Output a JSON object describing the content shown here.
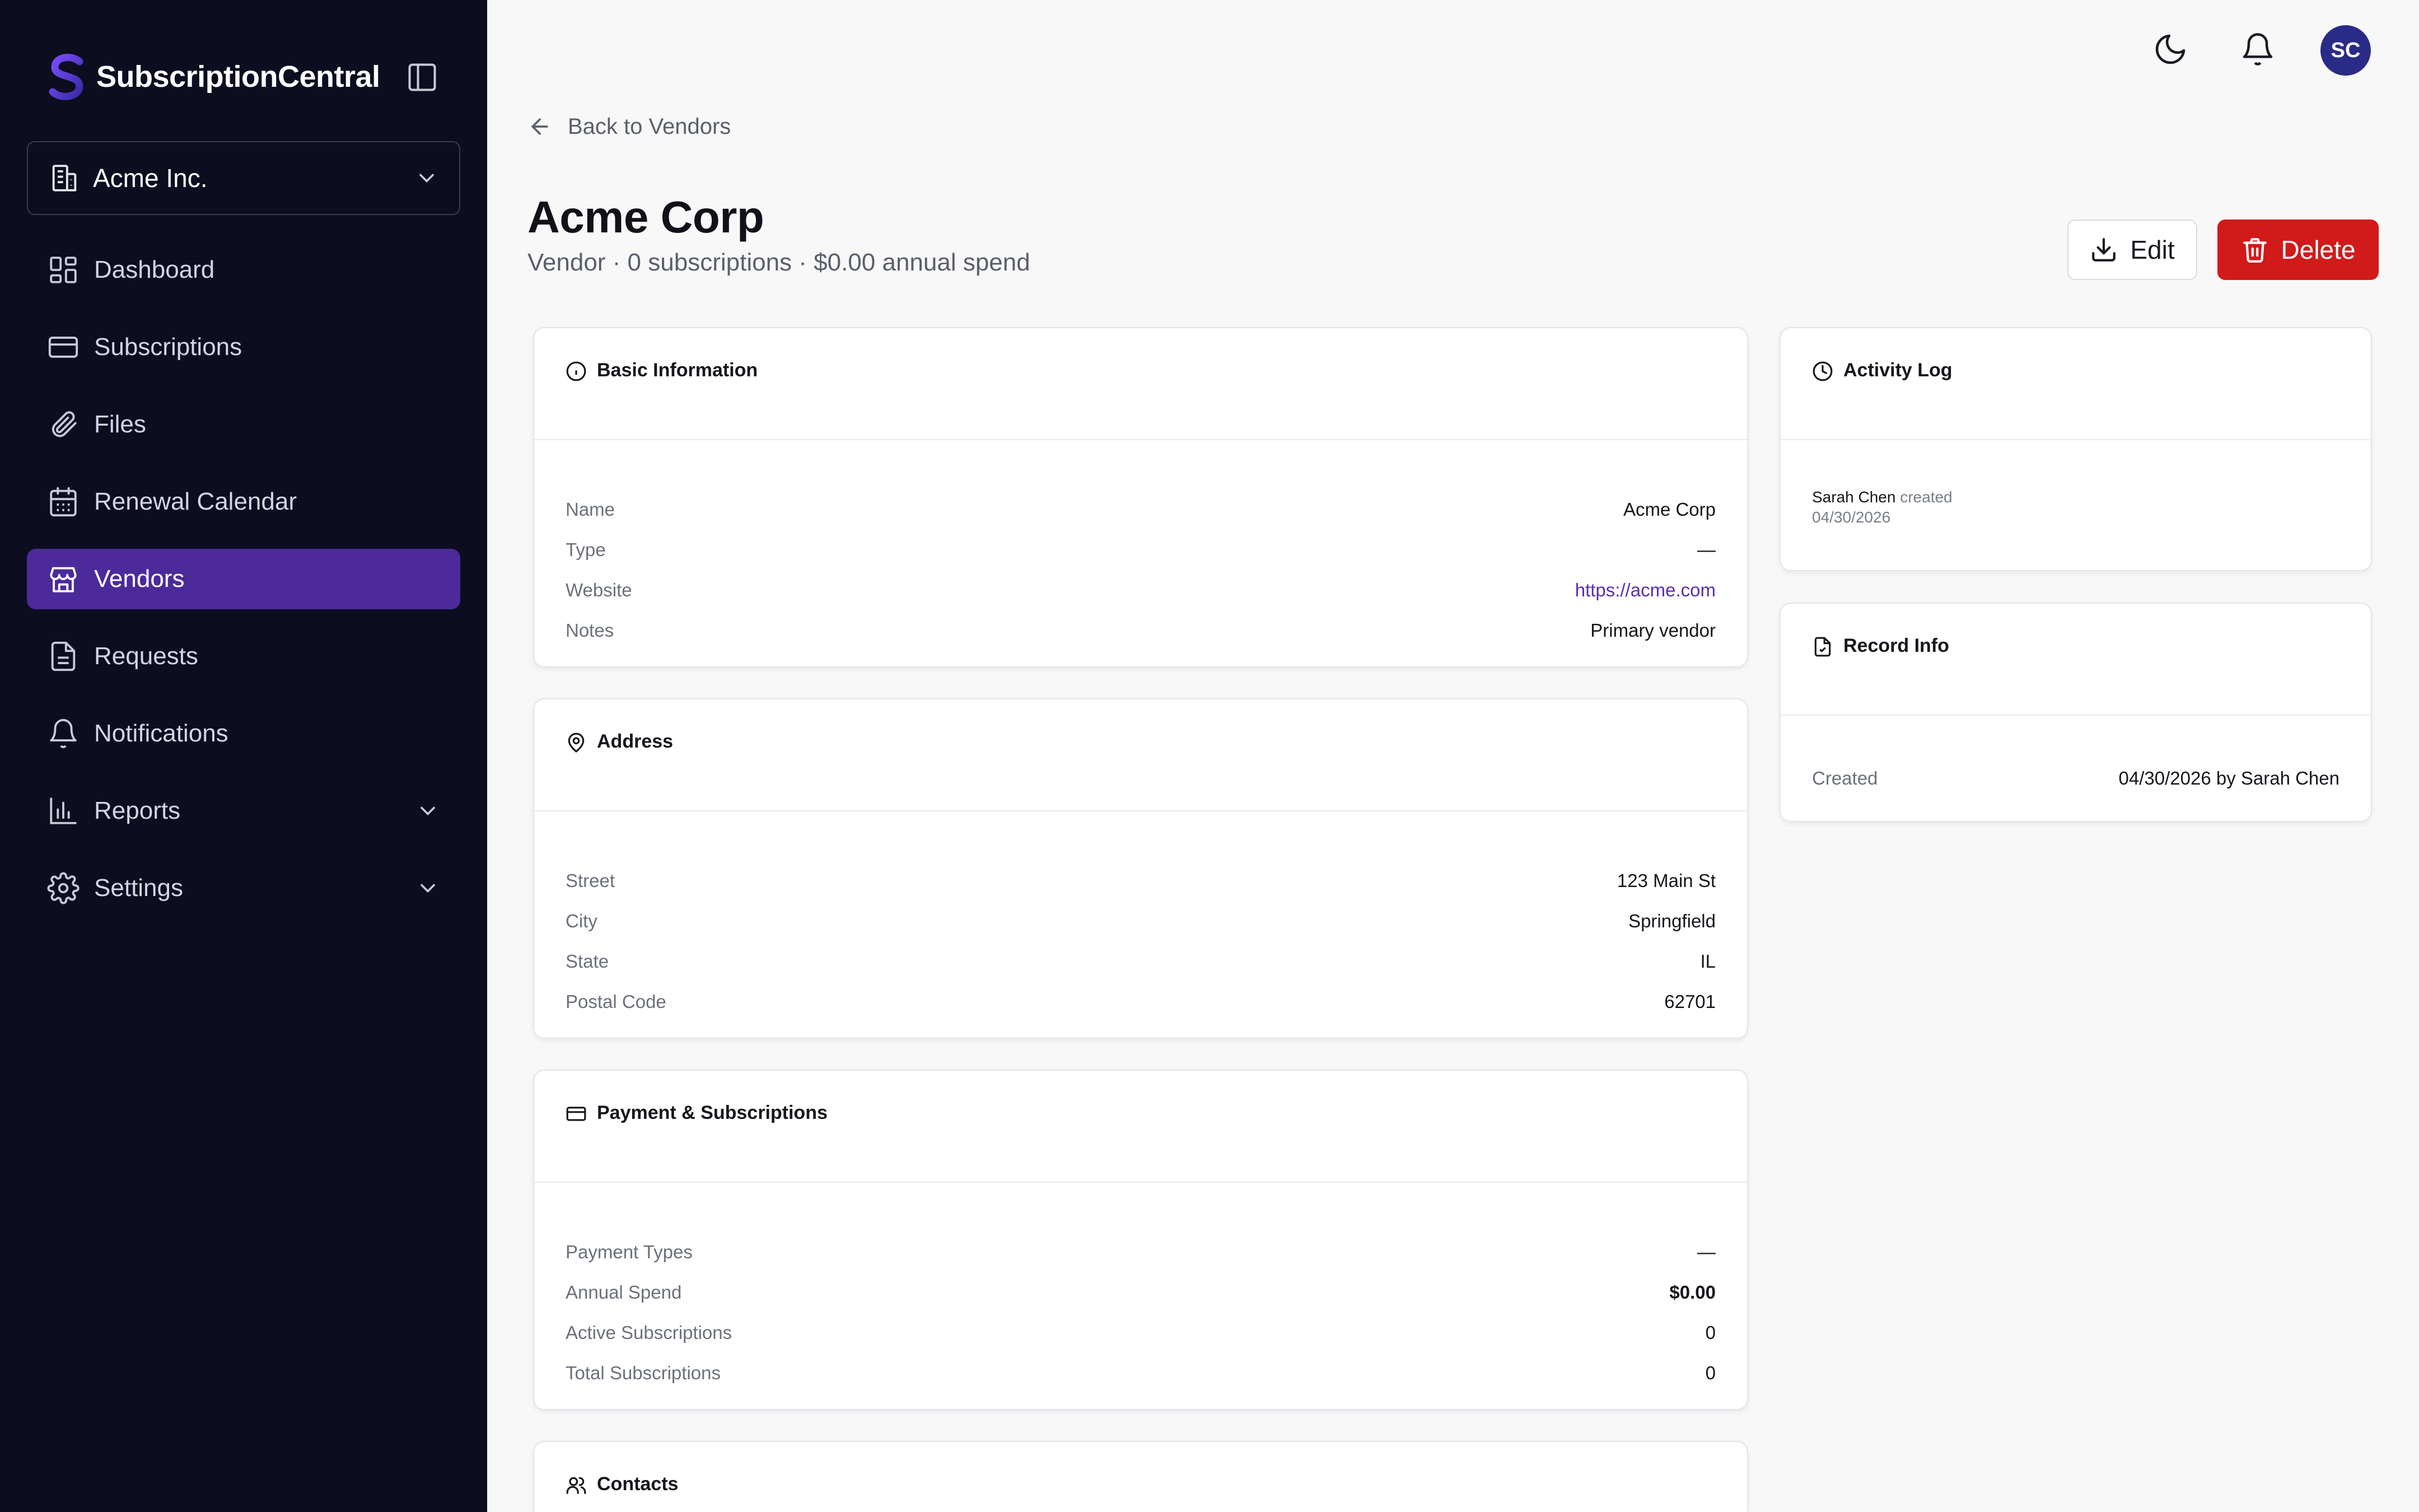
{
  "app": {
    "name": "SubscriptionCentral"
  },
  "org": {
    "name": "Acme Inc."
  },
  "nav": {
    "items": [
      {
        "label": "Dashboard",
        "icon": "dashboard-icon"
      },
      {
        "label": "Subscriptions",
        "icon": "credit-card-icon"
      },
      {
        "label": "Files",
        "icon": "paperclip-icon"
      },
      {
        "label": "Renewal Calendar",
        "icon": "calendar-icon"
      },
      {
        "label": "Vendors",
        "icon": "store-icon",
        "active": true
      },
      {
        "label": "Requests",
        "icon": "document-icon"
      },
      {
        "label": "Notifications",
        "icon": "bell-icon"
      },
      {
        "label": "Reports",
        "icon": "bar-chart-icon",
        "expandable": true
      },
      {
        "label": "Settings",
        "icon": "gear-icon",
        "expandable": true
      }
    ]
  },
  "topbar": {
    "avatar_initials": "SC"
  },
  "header": {
    "back_label": "Back to Vendors",
    "title": "Acme Corp",
    "subtitle": "Vendor · 0 subscriptions · $0.00 annual spend",
    "edit_label": "Edit",
    "delete_label": "Delete"
  },
  "basic_info": {
    "title": "Basic Information",
    "rows": [
      {
        "label": "Name",
        "value": "Acme Corp"
      },
      {
        "label": "Type",
        "value": "—"
      },
      {
        "label": "Website",
        "value": "https://acme.com"
      },
      {
        "label": "Notes",
        "value": "Primary vendor"
      }
    ]
  },
  "address": {
    "title": "Address",
    "rows": [
      {
        "label": "Street",
        "value": "123 Main St"
      },
      {
        "label": "City",
        "value": "Springfield"
      },
      {
        "label": "State",
        "value": "IL"
      },
      {
        "label": "Postal Code",
        "value": "62701"
      }
    ]
  },
  "payment": {
    "title": "Payment & Subscriptions",
    "rows": [
      {
        "label": "Payment Types",
        "value": "—"
      },
      {
        "label": "Annual Spend",
        "value": "$0.00"
      },
      {
        "label": "Active Subscriptions",
        "value": "0"
      },
      {
        "label": "Total Subscriptions",
        "value": "0"
      }
    ]
  },
  "contacts": {
    "title": "Contacts"
  },
  "activity_log": {
    "title": "Activity Log",
    "entries": [
      {
        "user": "Sarah Chen",
        "action": "created",
        "date": "04/30/2026"
      }
    ]
  },
  "record_info": {
    "title": "Record Info",
    "rows": [
      {
        "label": "Created",
        "value": "04/30/2026 by Sarah Chen"
      }
    ]
  },
  "colors": {
    "sidebar_bg": "#0c0d1f",
    "accent": "#4c2a9a",
    "danger": "#d11a1a",
    "link": "#5b2db0",
    "avatar_bg": "#2a2b86"
  }
}
